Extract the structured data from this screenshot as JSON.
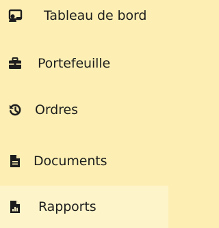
{
  "sidebar": {
    "active_index": 4,
    "colors": {
      "background": "#fdefb4",
      "active_background": "#fdf4c9",
      "text": "#1d1d1d"
    },
    "items": [
      {
        "label": "Tableau de bord",
        "icon": "dashboard-user-icon"
      },
      {
        "label": "Portefeuille",
        "icon": "briefcase-icon"
      },
      {
        "label": "Ordres",
        "icon": "history-icon"
      },
      {
        "label": "Documents",
        "icon": "document-icon"
      },
      {
        "label": "Rapports",
        "icon": "report-icon"
      }
    ]
  }
}
